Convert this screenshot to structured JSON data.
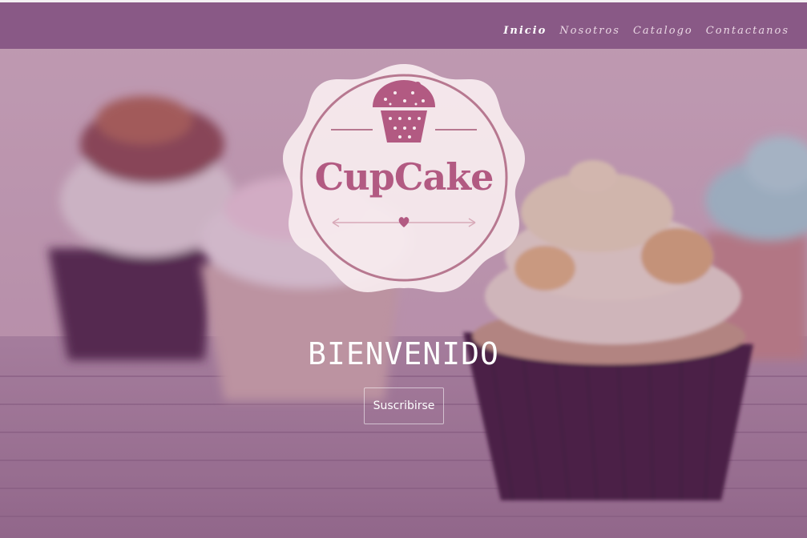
{
  "nav": {
    "items": [
      {
        "label": "Inicio",
        "active": true
      },
      {
        "label": "Nosotros",
        "active": false
      },
      {
        "label": "Catalogo",
        "active": false
      },
      {
        "label": "Contactanos",
        "active": false
      }
    ]
  },
  "hero": {
    "brand": "CupCake",
    "welcome": "BIENVENIDO",
    "subscribe_label": "Suscribirse"
  },
  "colors": {
    "nav_bg": "#7a467a",
    "brand": "#b25a82",
    "badge_bg": "#f7ecef",
    "overlay": "#783c6e"
  },
  "icons": [
    "cupcake-icon",
    "heart-icon"
  ]
}
